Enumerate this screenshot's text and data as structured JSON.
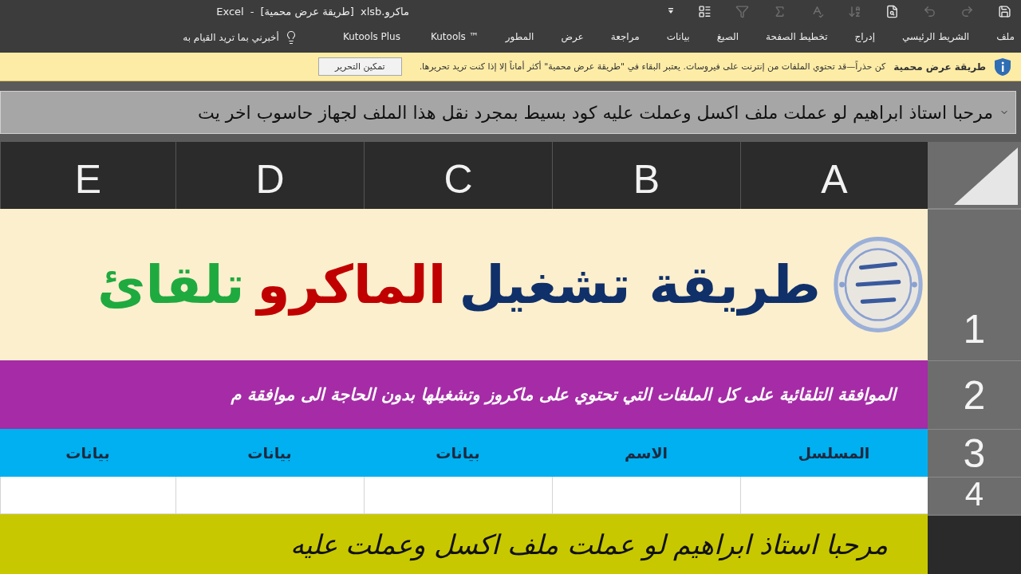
{
  "window": {
    "title_parts": [
      "ماكرو.xlsb",
      "[طريقة عرض محمية]",
      "-",
      "Excel"
    ]
  },
  "quick_access": [
    {
      "kind": "save",
      "disabled": false
    },
    {
      "kind": "redo",
      "disabled": true
    },
    {
      "kind": "undo",
      "disabled": true
    },
    {
      "kind": "preview",
      "disabled": false
    },
    {
      "kind": "sort",
      "disabled": true
    },
    {
      "kind": "spelling",
      "disabled": true
    },
    {
      "kind": "sum",
      "disabled": true
    },
    {
      "kind": "filter",
      "disabled": true
    },
    {
      "kind": "form",
      "disabled": false
    },
    {
      "kind": "customize",
      "disabled": false
    }
  ],
  "tabs": [
    {
      "label": "ملف",
      "selected": false
    },
    {
      "label": "الشريط الرئيسي",
      "selected": false
    },
    {
      "label": "إدراج",
      "selected": false
    },
    {
      "label": "تخطيط الصفحة",
      "selected": false
    },
    {
      "label": "الصيغ",
      "selected": false
    },
    {
      "label": "بيانات",
      "selected": false
    },
    {
      "label": "مراجعة",
      "selected": false
    },
    {
      "label": "عرض",
      "selected": false
    },
    {
      "label": "المطور",
      "selected": false
    },
    {
      "label": "Kutools ™",
      "selected": false
    },
    {
      "label": "Kutools Plus",
      "selected": false
    }
  ],
  "tell_me": {
    "placeholder": "أخبرني بما تريد القيام به"
  },
  "protected_view_bar": {
    "title": "طريقة عرض محمية",
    "message": "كن حذراً—قد تحتوي الملفات من إنترنت على فيروسات. يعتبر البقاء في \"طريقة عرض محمية\" أكثر أماناً إلا إذا كنت تريد تحريرها.",
    "button": "تمكين التحرير"
  },
  "formula_bar": {
    "value": "مرحبا استاذ ابراهيم لو عملت ملف اكسل وعملت عليه كود بسيط بمجرد نقل هذا الملف لجهاز حاسوب اخر يت"
  },
  "sheet": {
    "columns": [
      "A",
      "B",
      "C",
      "D",
      "E"
    ],
    "rows": [
      {
        "header": "1",
        "kind": "banner",
        "segments": [
          {
            "text": "طريقة تشغيل",
            "color": "#10306a"
          },
          {
            "text": "الماكرو",
            "color": "#c00000"
          },
          {
            "text": "تلقائ",
            "color": "#1faa40"
          }
        ]
      },
      {
        "header": "2",
        "kind": "subtitle",
        "text": "الموافقة التلقائية على كل الملفات التي تحتوي على ماكروز وتشغيلها بدون الحاجة الى موافقة م"
      },
      {
        "header": "3",
        "kind": "headers",
        "cells": [
          "المسلسل",
          "الاسم",
          "بيانات",
          "بيانات",
          "بيانات"
        ]
      },
      {
        "header": "4",
        "kind": "empty"
      },
      {
        "kind": "script",
        "text": "مرحبا استاذ ابراهيم لو عملت ملف اكسل وعملت عليه"
      }
    ]
  }
}
